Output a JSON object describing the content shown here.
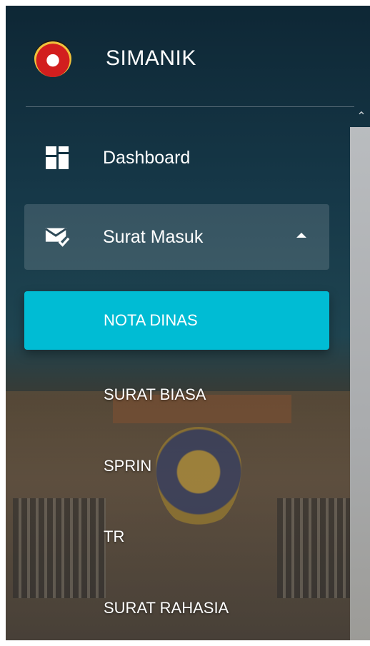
{
  "app": {
    "name": "SIMANIK",
    "logo": "police-emblem-icon"
  },
  "menu": {
    "dashboard": {
      "label": "Dashboard",
      "icon": "dashboard-icon"
    },
    "surat_masuk": {
      "label": "Surat Masuk",
      "icon": "mail-check-icon",
      "expanded": true,
      "submenu": [
        {
          "label": "NOTA DINAS",
          "active": true
        },
        {
          "label": "SURAT BIASA",
          "active": false
        },
        {
          "label": "SPRIN",
          "active": false
        },
        {
          "label": "TR",
          "active": false
        },
        {
          "label": "SURAT RAHASIA",
          "active": false
        }
      ]
    }
  },
  "colors": {
    "active": "#00bcd4",
    "sidebar": "#0e2735",
    "text": "#ffffff"
  }
}
